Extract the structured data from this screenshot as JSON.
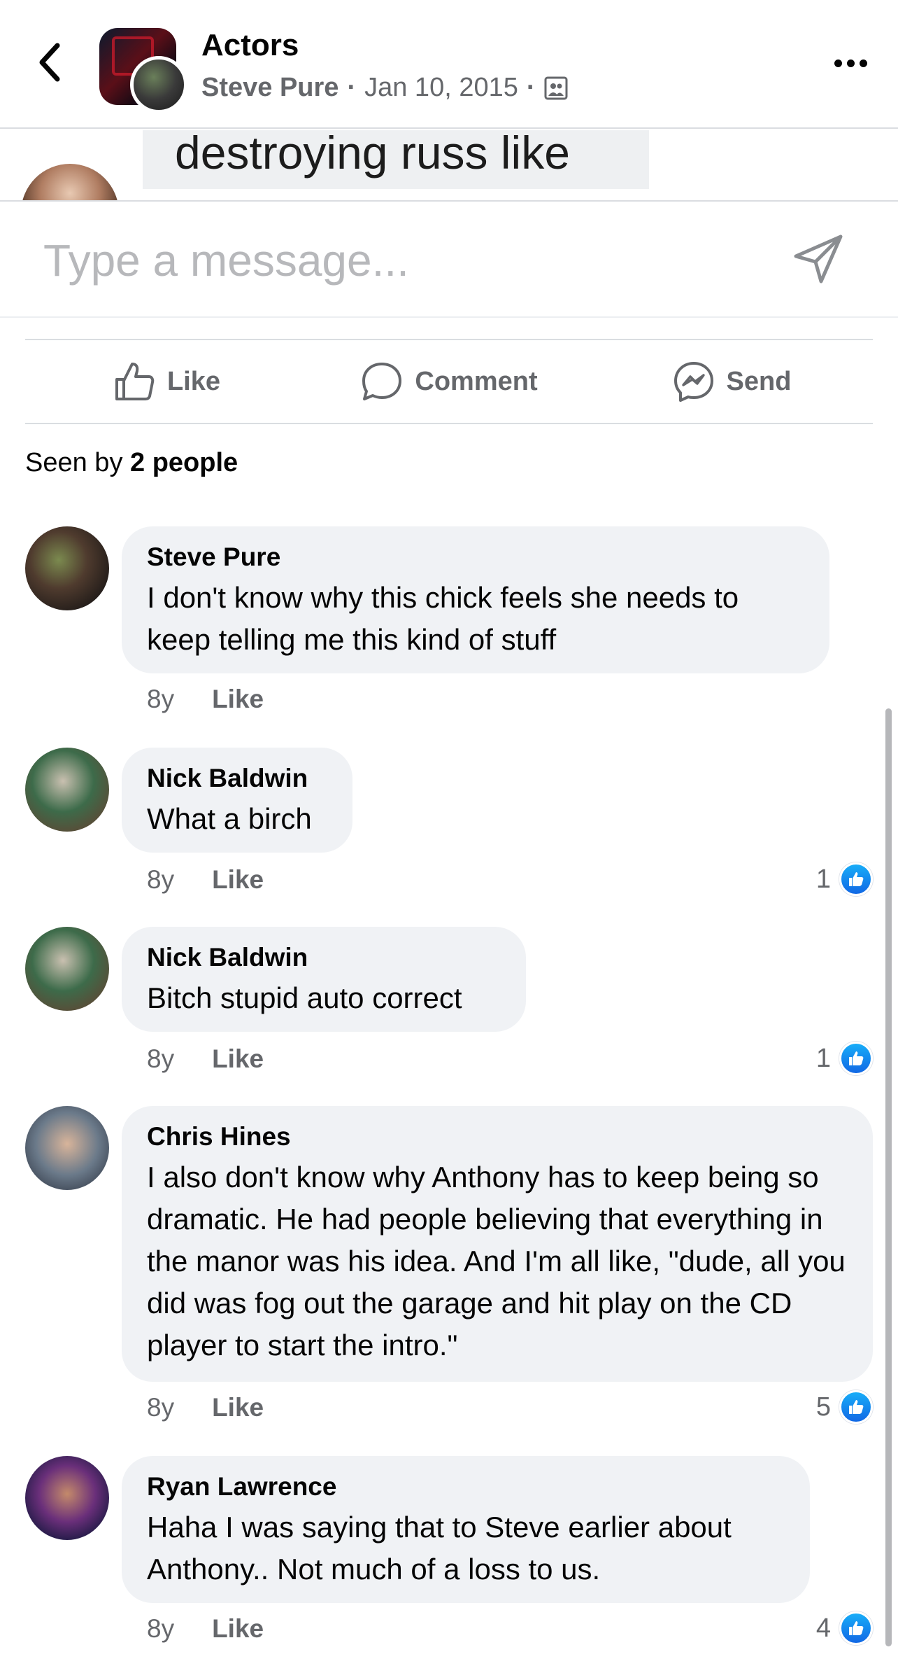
{
  "header": {
    "group_title": "Actors",
    "author": "Steve Pure",
    "separator": "·",
    "date": "Jan 10, 2015"
  },
  "previous_post": {
    "cropped_text": "destroying russ like"
  },
  "composer": {
    "placeholder": "Type a message..."
  },
  "actions": {
    "like": "Like",
    "comment": "Comment",
    "send": "Send"
  },
  "seen": {
    "prefix": "Seen by",
    "count": "2 people"
  },
  "comments": [
    {
      "name": "Steve Pure",
      "text": "I don't know why this chick feels she needs to keep telling me this kind of stuff",
      "age": "8y",
      "like": "Like",
      "reactions": ""
    },
    {
      "name": "Nick Baldwin",
      "text": "What a birch",
      "age": "8y",
      "like": "Like",
      "reactions": "1"
    },
    {
      "name": "Nick Baldwin",
      "text": "Bitch stupid auto correct",
      "age": "8y",
      "like": "Like",
      "reactions": "1"
    },
    {
      "name": "Chris Hines",
      "text": "I also don't know why Anthony has to keep being so dramatic. He had people believing that everything in the manor was his idea. And I'm all like, \"dude, all you did was fog out the garage and hit play on the CD player to start the intro.\"",
      "age": "8y",
      "like": "Like",
      "reactions": "5"
    },
    {
      "name": "Ryan Lawrence",
      "text": "Haha I was saying that to Steve earlier about Anthony.. Not much of a loss to us.",
      "age": "8y",
      "like": "Like",
      "reactions": "4"
    }
  ],
  "colors": {
    "secondary_text": "#65676b",
    "bubble_bg": "#f0f2f5",
    "like_badge": "#1877f2",
    "divider": "#dadde1"
  },
  "icons": [
    "back-arrow-icon",
    "more-icon",
    "group-privacy-icon",
    "send-arrow-icon",
    "thumbs-up-icon",
    "comment-icon",
    "messenger-icon",
    "like-badge-icon"
  ]
}
